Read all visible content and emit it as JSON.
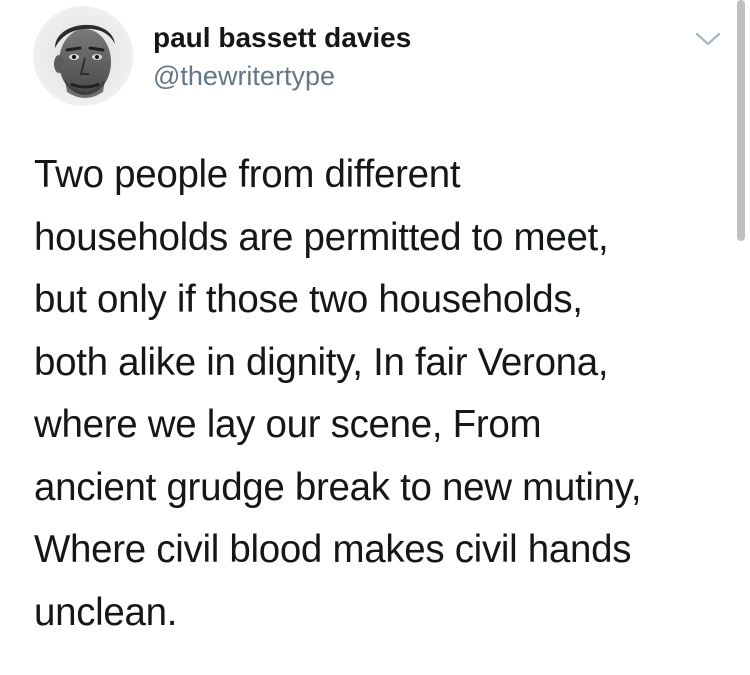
{
  "tweet": {
    "display_name": "paul bassett davies",
    "handle": "@thewritertype",
    "text_lines": [
      "Two people from different",
      "households are permitted to meet,",
      "but only if those two households,",
      "both alike in dignity, In fair Verona,",
      "where we lay our scene, From",
      "ancient grudge break to new mutiny,",
      "Where civil blood makes civil hands",
      "unclean."
    ]
  },
  "icons": {
    "avatar": "profile-photo",
    "menu": "chevron-down-icon"
  },
  "colors": {
    "name": "#14171a",
    "handle": "#657786",
    "text": "#14171a",
    "chevron": "#aab8c2",
    "background": "#ffffff"
  }
}
